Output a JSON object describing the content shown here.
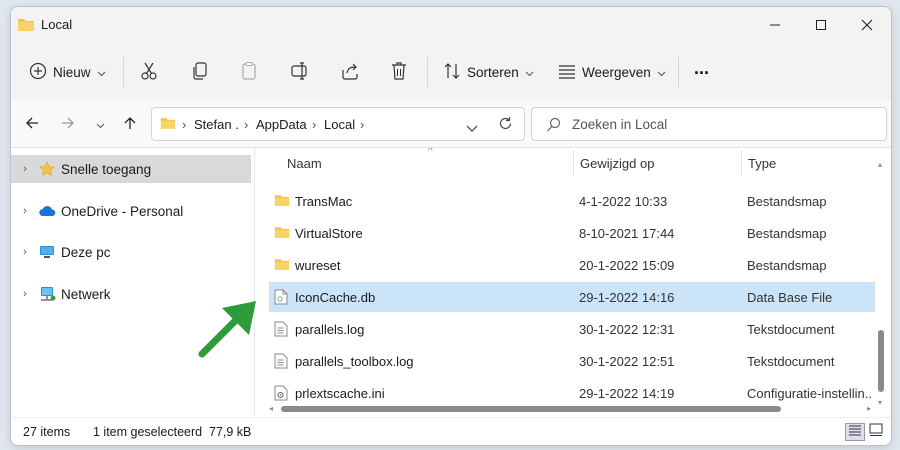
{
  "window": {
    "title": "Local"
  },
  "toolbar": {
    "new_label": "Nieuw",
    "sort_label": "Sorteren",
    "view_label": "Weergeven",
    "more_label": "..."
  },
  "address": {
    "crumb1": "Stefan .",
    "crumb2": "AppData",
    "crumb3": "Local"
  },
  "search": {
    "placeholder": "Zoeken in Local"
  },
  "sidebar": {
    "items": [
      {
        "label": "Snelle toegang",
        "icon": "star-icon"
      },
      {
        "label": "OneDrive - Personal",
        "icon": "onedrive-icon"
      },
      {
        "label": "Deze pc",
        "icon": "computer-icon"
      },
      {
        "label": "Netwerk",
        "icon": "network-icon"
      }
    ]
  },
  "columns": {
    "name": "Naam",
    "modified": "Gewijzigd op",
    "type": "Type"
  },
  "files": [
    {
      "name": "TransMac",
      "date": "4-1-2022 10:33",
      "type": "Bestandsmap",
      "icon": "folder-icon"
    },
    {
      "name": "VirtualStore",
      "date": "8-10-2021 17:44",
      "type": "Bestandsmap",
      "icon": "folder-icon"
    },
    {
      "name": "wureset",
      "date": "20-1-2022 15:09",
      "type": "Bestandsmap",
      "icon": "folder-icon"
    },
    {
      "name": "IconCache.db",
      "date": "29-1-2022 14:16",
      "type": "Data Base File",
      "icon": "file-icon"
    },
    {
      "name": "parallels.log",
      "date": "30-1-2022 12:31",
      "type": "Tekstdocument",
      "icon": "text-file-icon"
    },
    {
      "name": "parallels_toolbox.log",
      "date": "30-1-2022 12:51",
      "type": "Tekstdocument",
      "icon": "text-file-icon"
    },
    {
      "name": "prlextscache.ini",
      "date": "29-1-2022 14:19",
      "type": "Configuratie-instellin...",
      "icon": "settings-file-icon"
    }
  ],
  "status": {
    "count": "27 items",
    "selected": "1 item geselecteerd",
    "size": "77,9 kB"
  },
  "colors": {
    "selection": "#cce4f7",
    "arrow": "#2e9b3a",
    "folder": "#f4c543"
  }
}
